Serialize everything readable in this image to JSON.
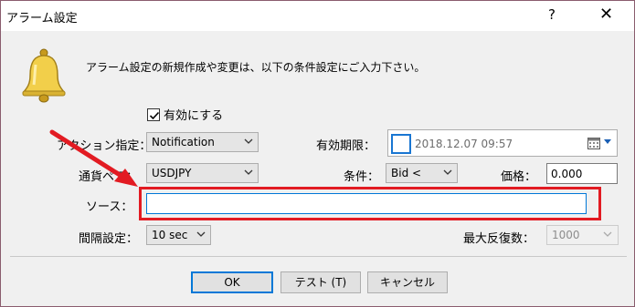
{
  "window": {
    "title": "アラーム設定",
    "help": "?",
    "close": "✕"
  },
  "intro": "アラーム設定の新規作成や変更は、以下の条件設定にご入力下さい。",
  "enable": {
    "label": "有効にする",
    "checked": true
  },
  "action": {
    "label": "アクション指定：",
    "value": "Notification"
  },
  "expiry": {
    "label": "有効期限：",
    "value": "2018.12.07 09:57"
  },
  "pair": {
    "label": "通貨ペア：",
    "value": "USDJPY"
  },
  "condition": {
    "label": "条件：",
    "value": "Bid <"
  },
  "price": {
    "label": "価格：",
    "value": "0.000"
  },
  "source": {
    "label": "ソース：",
    "value": ""
  },
  "interval": {
    "label": "間隔設定：",
    "value": "10 sec"
  },
  "max_repeat": {
    "label": "最大反復数：",
    "value": "1000"
  },
  "buttons": {
    "ok": "OK",
    "test": "テスト (T)",
    "cancel": "キャンセル"
  },
  "colors": {
    "highlight": "#e21b22",
    "focus": "#0078d7",
    "bell": "#e8c23a"
  }
}
